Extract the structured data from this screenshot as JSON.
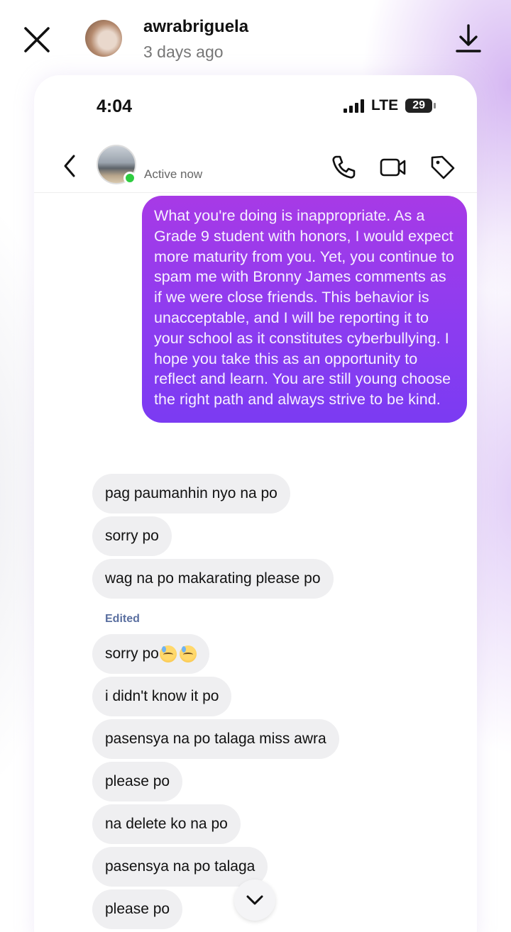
{
  "story": {
    "username": "awrabriguela",
    "time_ago": "3 days ago"
  },
  "status_bar": {
    "time": "4:04",
    "network": "LTE",
    "battery": "29"
  },
  "chat": {
    "presence": "Active now",
    "sent_message": "What you're doing is inappropriate. As a Grade 9 student with honors, I would expect more maturity from you. Yet, you continue to spam me with Bronny James comments as if we were close friends. This behavior is unacceptable, and I will be reporting it to your school as it constitutes cyberbullying. I hope you take this as an opportunity to reflect and learn. You are still young choose the right path and always strive to be kind.",
    "received_before_edit": [
      "pag paumanhin nyo na po",
      "sorry po",
      "wag na po makarating please po"
    ],
    "edited_label": "Edited",
    "edited_message": "sorry po",
    "edited_emojis": [
      "downcast-face-with-sweat-emoji",
      "downcast-face-with-sweat-emoji"
    ],
    "received_after_edit": [
      "i didn't know it po",
      "pasensya na po talaga miss awra",
      "please po",
      "na delete ko na po",
      "pasensya na po talaga",
      "please po"
    ]
  },
  "icons": {
    "close": "close-icon",
    "download": "download-icon",
    "back": "chevron-left-icon",
    "call": "phone-icon",
    "video": "video-camera-icon",
    "tag": "tag-icon",
    "scroll": "chevron-down-icon"
  },
  "colors": {
    "sent_bubble_top": "#a73ae6",
    "sent_bubble_bottom": "#7b3bf2",
    "received_bubble": "#efeff1",
    "online": "#2ecc40",
    "edited_label": "#5a6fa0"
  }
}
